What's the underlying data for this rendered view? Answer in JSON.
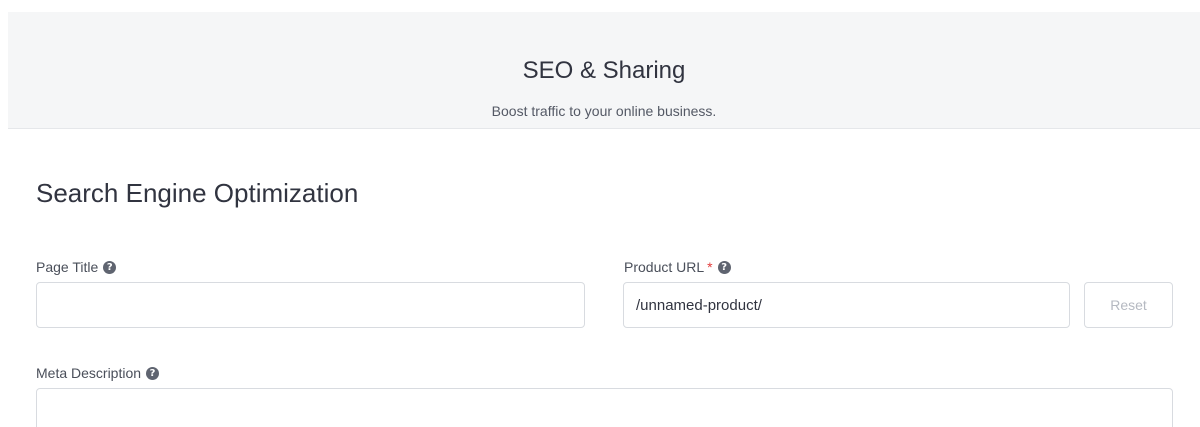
{
  "header": {
    "title": "SEO & Sharing",
    "subtitle": "Boost traffic to your online business."
  },
  "seo": {
    "section_title": "Search Engine Optimization",
    "page_title": {
      "label": "Page Title",
      "value": ""
    },
    "product_url": {
      "label": "Product URL",
      "required_mark": "*",
      "value": "/unnamed-product/",
      "reset_label": "Reset"
    },
    "meta_description": {
      "label": "Meta Description",
      "value": ""
    },
    "help_glyph": "?"
  },
  "icons": {
    "help": "help-circle-icon"
  },
  "colors": {
    "header_bg": "#f5f6f7",
    "required": "#e23b3b",
    "border": "#d8dbe0"
  }
}
